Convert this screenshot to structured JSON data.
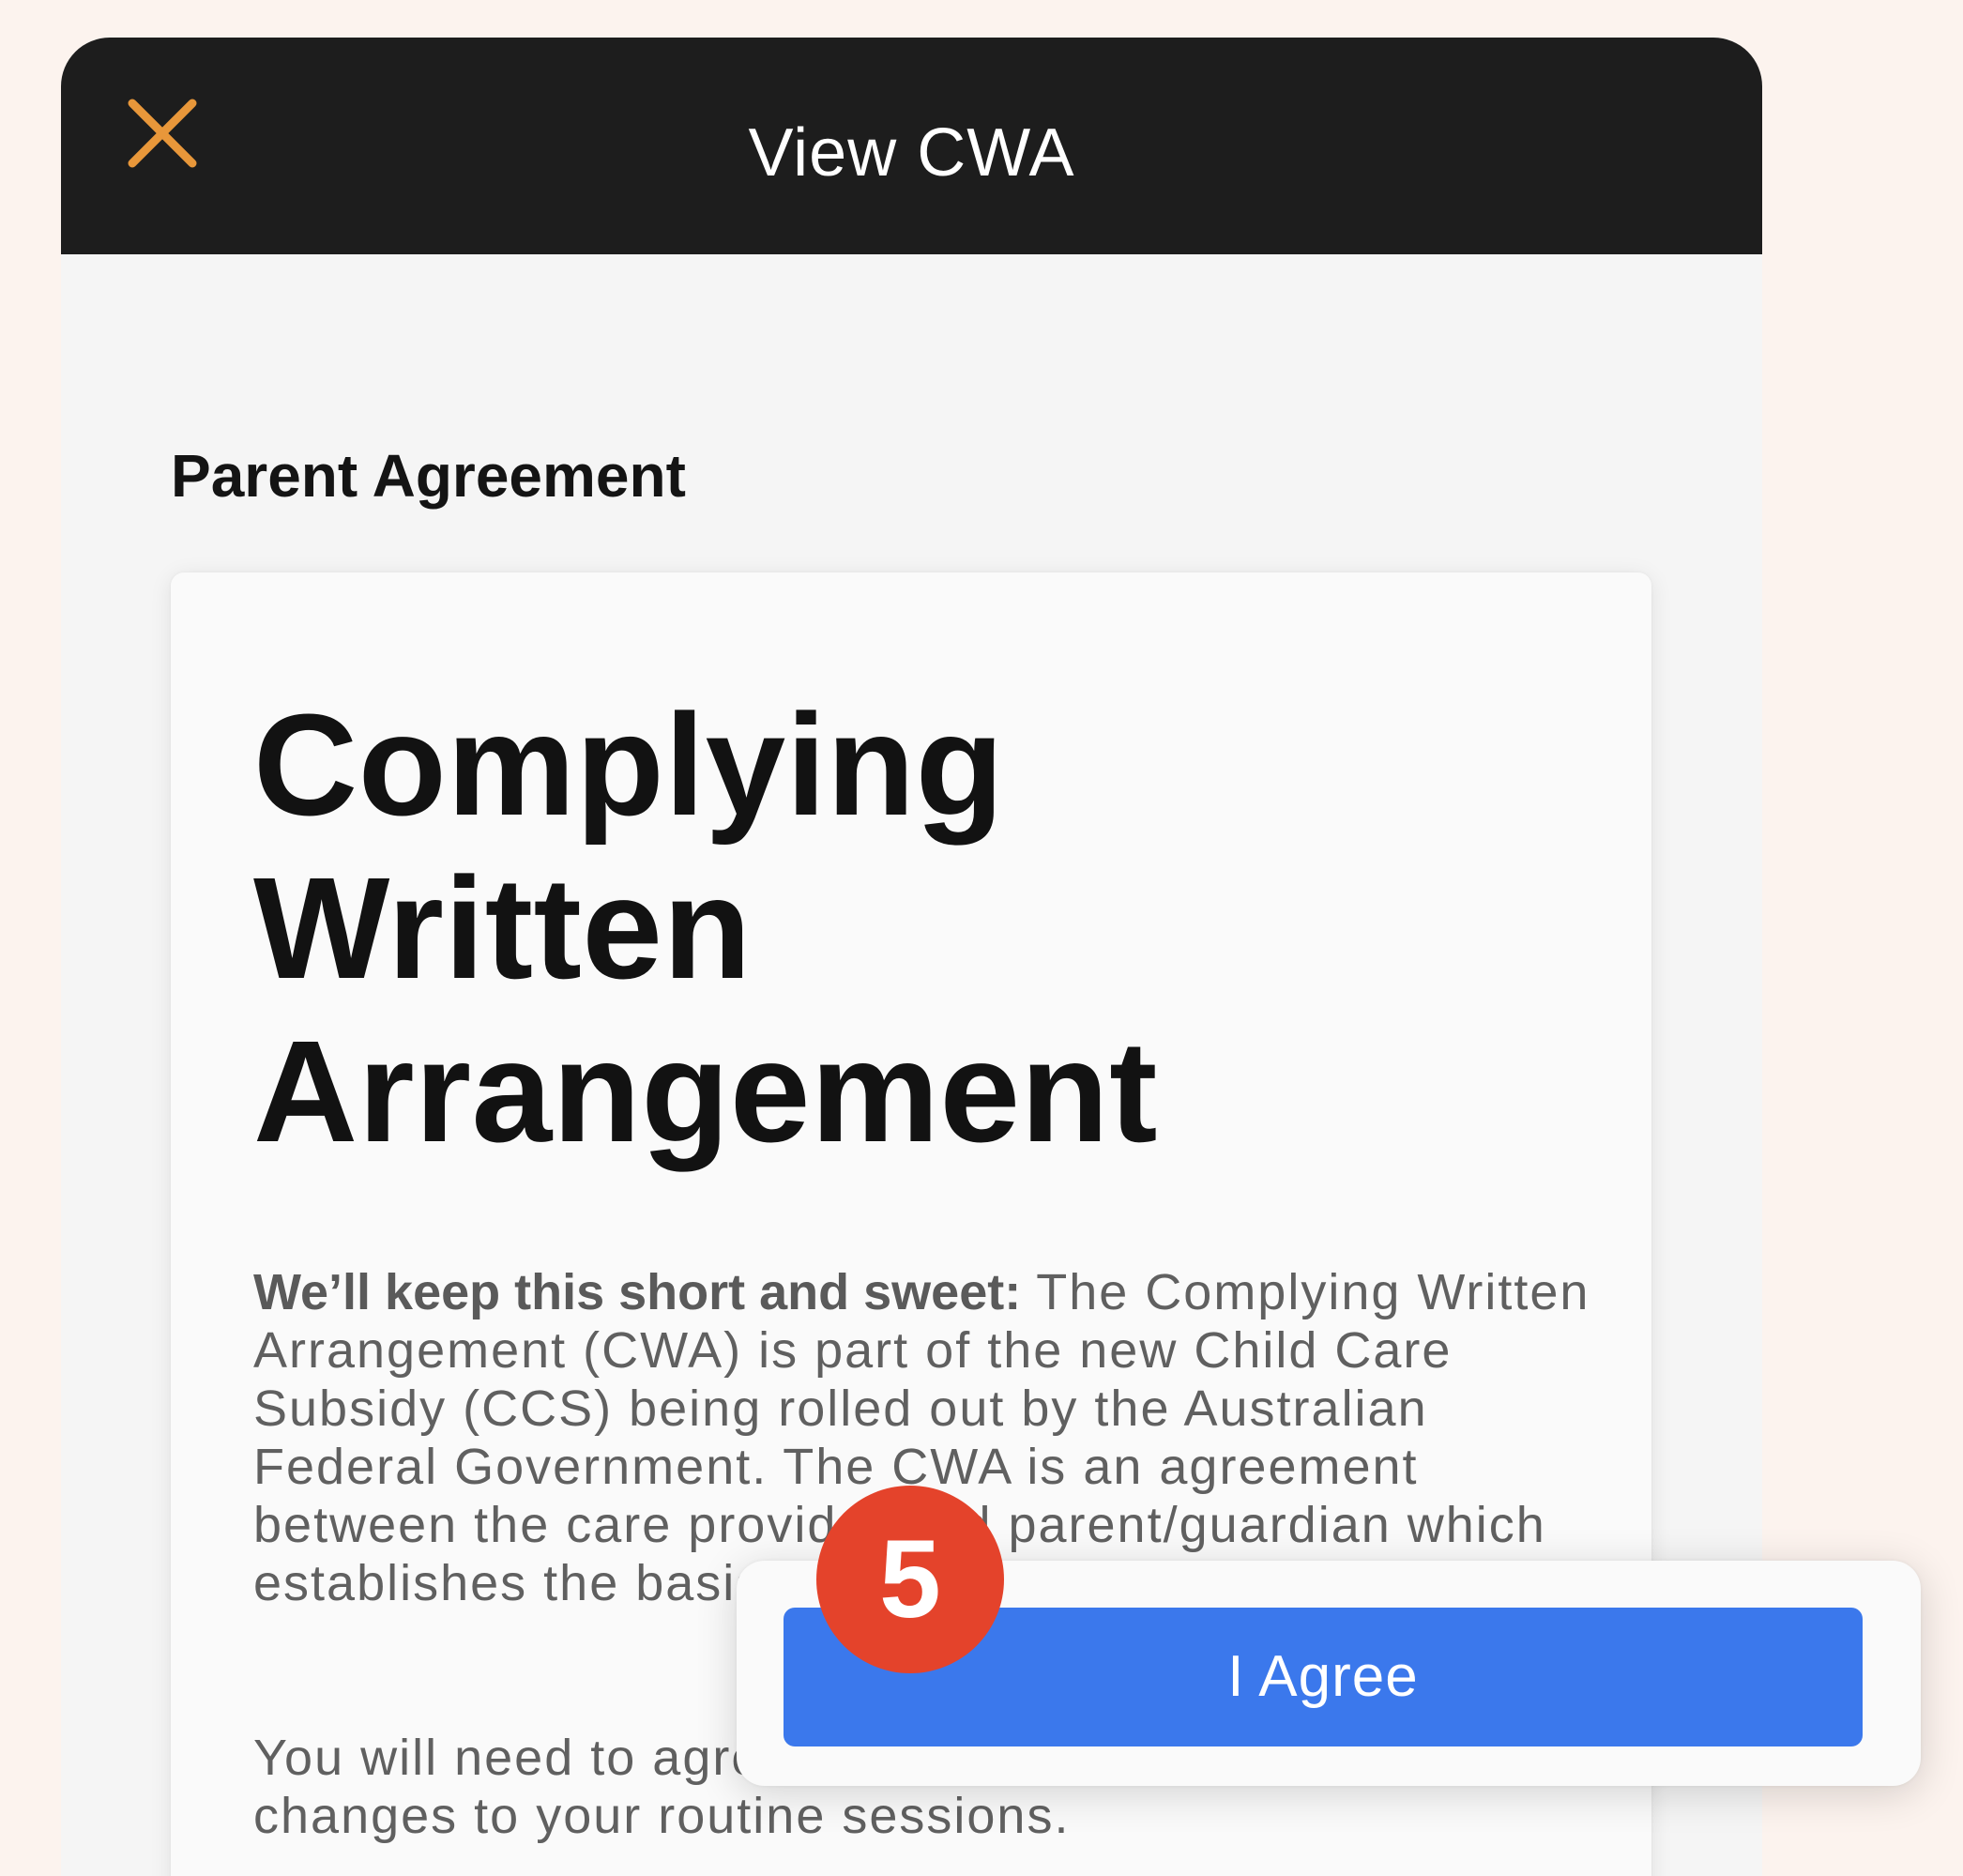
{
  "navbar": {
    "title": "View CWA",
    "close_icon": "close-icon",
    "accent_color": "#e8973a"
  },
  "section": {
    "heading": "Parent Agreement"
  },
  "document": {
    "title_lines": [
      "Complying",
      "Written",
      "Arrangement"
    ],
    "intro_lead": "We’ll keep this short and sweet:",
    "intro_body": " The Complying Written Arrangement (CWA) is part of the new Child Care Subsidy (CCS) being rolled out by the Australian Federal Government. The CWA is an agreement between the care provider and parent/guardian which establishes the basis on which care will be provided.",
    "second_paragraph": "You will need to agree to the CWA and any future changes to your routine sessions."
  },
  "actions": {
    "agree_label": "I Agree",
    "agree_color": "#3b78ec"
  },
  "overlay": {
    "step_number": "5",
    "badge_color": "#e4432b"
  }
}
